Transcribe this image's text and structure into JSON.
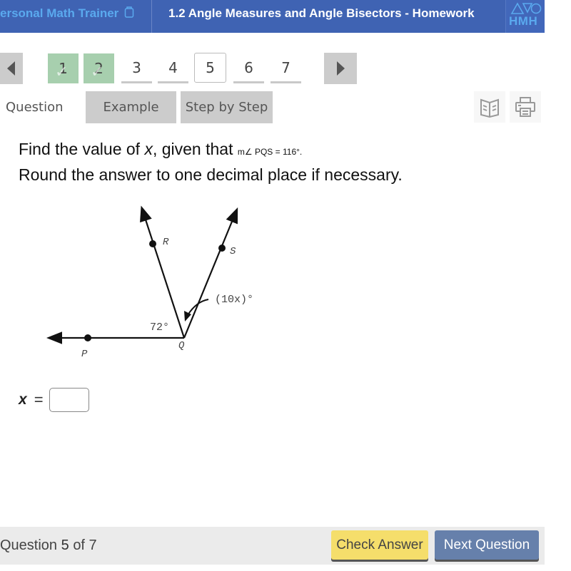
{
  "header": {
    "app_name": "ersonal Math Trainer",
    "assignment_title": "1.2 Angle Measures and Angle Bisectors - Homework",
    "logo_text": "HMH"
  },
  "question_nav": {
    "questions": [
      {
        "label": "1",
        "status": "completed"
      },
      {
        "label": "2",
        "status": "completed"
      },
      {
        "label": "3",
        "status": "pending"
      },
      {
        "label": "4",
        "status": "pending"
      },
      {
        "label": "5",
        "status": "current"
      },
      {
        "label": "6",
        "status": "pending"
      },
      {
        "label": "7",
        "status": "pending"
      }
    ]
  },
  "tabs": [
    {
      "label": "Question",
      "active": true
    },
    {
      "label": "Example",
      "active": false
    },
    {
      "label": "Step by Step",
      "active": false
    }
  ],
  "tools": {
    "book_icon": "open-book-icon",
    "print_icon": "printer-icon"
  },
  "problem": {
    "line1_prefix": "Find the value of ",
    "variable": "x",
    "line1_mid": ", given that ",
    "given": "m∠ PQS = 116°.",
    "line2": "Round the answer to one decimal place if necessary."
  },
  "figure": {
    "points": {
      "P": "P",
      "Q": "Q",
      "R": "R",
      "S": "S"
    },
    "angle_PQR": "72°",
    "angle_RQS": "(10x)°"
  },
  "answer": {
    "variable": "x",
    "equals": "=",
    "value": ""
  },
  "footer": {
    "question_word": "Question",
    "current": "5",
    "of_text": "of 7",
    "check_answer": "Check Answer",
    "next_question": "Next Question"
  },
  "colors": {
    "header_bg": "#3f63b3",
    "completed": "#a7cfae",
    "check_btn": "#f5de6b",
    "next_btn": "#6680ab"
  }
}
